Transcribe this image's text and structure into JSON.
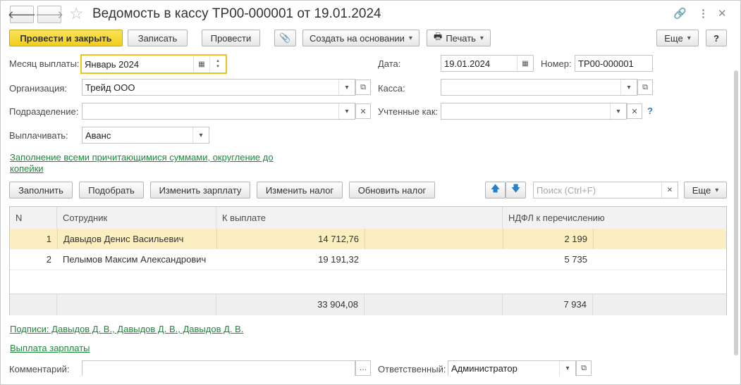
{
  "title": "Ведомость в кассу ТР00-000001 от 19.01.2024",
  "toolbar": {
    "post_close": "Провести и закрыть",
    "save": "Записать",
    "post": "Провести",
    "create_based": "Создать на основании",
    "print": "Печать",
    "more": "Еще",
    "help": "?"
  },
  "form": {
    "month_label": "Месяц выплаты:",
    "month_value": "Январь 2024",
    "date_label": "Дата:",
    "date_value": "19.01.2024",
    "number_label": "Номер:",
    "number_value": "ТР00-000001",
    "org_label": "Организация:",
    "org_value": "Трейд ООО",
    "kassa_label": "Касса:",
    "kassa_value": "",
    "dept_label": "Подразделение:",
    "dept_value": "",
    "counted_label": "Учтенные как:",
    "counted_value": "",
    "pay_label": "Выплачивать:",
    "pay_value": "Аванс",
    "fill_link_line1": "Заполнение всеми причитающимися суммами, округление до",
    "fill_link_line2": "копейки"
  },
  "table_toolbar": {
    "fill": "Заполнить",
    "pick": "Подобрать",
    "change_salary": "Изменить зарплату",
    "change_tax": "Изменить налог",
    "update_tax": "Обновить налог",
    "search_placeholder": "Поиск (Ctrl+F)",
    "more": "Еще"
  },
  "table": {
    "headers": [
      "N",
      "Сотрудник",
      "К выплате",
      "НДФЛ к перечислению"
    ],
    "rows": [
      {
        "n": "1",
        "employee": "Давыдов Денис Васильевич",
        "amount": "14 712,76",
        "tax": "2 199"
      },
      {
        "n": "2",
        "employee": "Пелымов Максим Александрович",
        "amount": "19 191,32",
        "tax": "5 735"
      }
    ],
    "totals": {
      "amount": "33 904,08",
      "tax": "7 934"
    }
  },
  "signatures_link": "Подписи: Давыдов Д. В., Давыдов Д. В., Давыдов Д. В.",
  "payout_link": "Выплата зарплаты",
  "footer": {
    "comment_label": "Комментарий:",
    "comment_value": "",
    "responsible_label": "Ответственный:",
    "responsible_value": "Администратор"
  },
  "colors": {
    "primary_button": "#f2cd1a",
    "link": "#1a8a3a",
    "selected_row": "#fbefc2",
    "focus_border": "#f0c419"
  }
}
